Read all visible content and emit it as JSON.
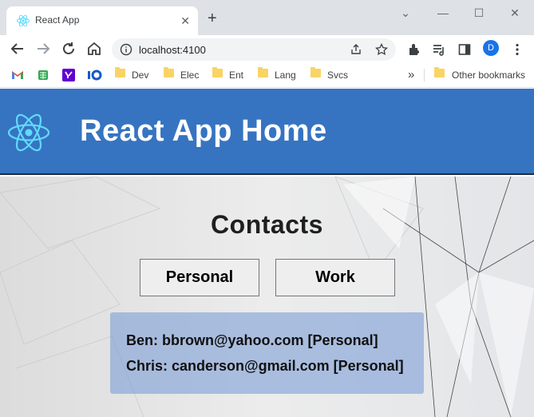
{
  "browser": {
    "tab_title": "React App",
    "tab_close": "✕",
    "new_tab": "+",
    "url": "localhost:4100",
    "avatar_initial": "D",
    "overflow_chevrons": "»",
    "window_controls": {
      "dropdown": "⌄",
      "minimize": "—",
      "maximize": "☐",
      "close": "✕"
    }
  },
  "bookmarks": [
    {
      "label": "Dev"
    },
    {
      "label": "Elec"
    },
    {
      "label": "Ent"
    },
    {
      "label": "Lang"
    },
    {
      "label": "Svcs"
    }
  ],
  "other_bookmarks": "Other bookmarks",
  "app": {
    "title": "React App Home",
    "accent_color": "#3674c1"
  },
  "contacts": {
    "heading": "Contacts",
    "filters": [
      "Personal",
      "Work"
    ],
    "items": [
      "Ben: bbrown@yahoo.com [Personal]",
      "Chris: canderson@gmail.com [Personal]"
    ]
  }
}
